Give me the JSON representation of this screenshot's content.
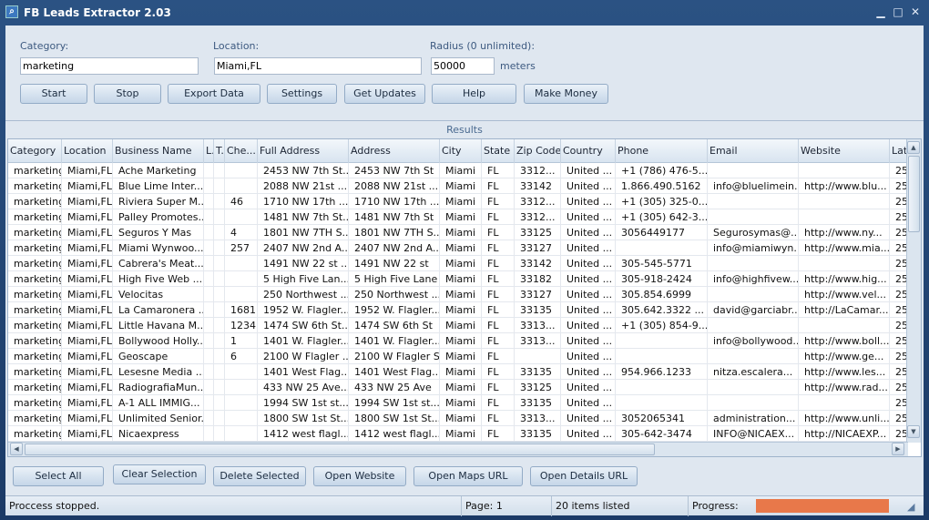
{
  "window": {
    "title": "FB Leads Extractor 2.03"
  },
  "form": {
    "category_label": "Category:",
    "category_value": "marketing",
    "location_label": "Location:",
    "location_value": "Miami,FL",
    "radius_label": "Radius (0 unlimited):",
    "radius_value": "50000",
    "radius_unit": "meters"
  },
  "toolbar": {
    "start": "Start",
    "stop": "Stop",
    "export": "Export Data",
    "settings": "Settings",
    "updates": "Get Updates",
    "help": "Help",
    "money": "Make Money"
  },
  "results_title": "Results",
  "table": {
    "columns": [
      "Category",
      "Location",
      "Business Name",
      "L.",
      "T.",
      "Che...",
      "Full Address",
      "Address",
      "City",
      "State",
      "Zip Code",
      "Country",
      "Phone",
      "Email",
      "Website",
      "Lat"
    ],
    "rows": [
      [
        "marketing",
        "Miami,FL",
        "Ache Marketing",
        "",
        "",
        "",
        "2453 NW 7th St...",
        "2453 NW 7th St",
        "Miami",
        "FL",
        "3312...",
        "United ...",
        "+1 (786) 476-5...",
        "",
        "",
        "25"
      ],
      [
        "marketing",
        "Miami,FL",
        "Blue Lime Inter...",
        "",
        "",
        "",
        "2088 NW 21st ...",
        "2088 NW 21st ...",
        "Miami",
        "FL",
        "33142",
        "United ...",
        "1.866.490.5162",
        "info@bluelimein...",
        "http://www.blu...",
        "25"
      ],
      [
        "marketing",
        "Miami,FL",
        "Riviera Super M...",
        "",
        "",
        "46",
        "1710 NW 17th ...",
        "1710 NW 17th ...",
        "Miami",
        "FL",
        "3312...",
        "United ...",
        "+1 (305) 325-0...",
        "",
        "",
        "25"
      ],
      [
        "marketing",
        "Miami,FL",
        "Palley Promotes...",
        "",
        "",
        "",
        "1481 NW 7th St...",
        "1481 NW 7th St",
        "Miami",
        "FL",
        "3312...",
        "United ...",
        "+1 (305) 642-3...",
        "",
        "",
        "25"
      ],
      [
        "marketing",
        "Miami,FL",
        "Seguros Y Mas",
        "",
        "",
        "4",
        "1801 NW 7TH S...",
        "1801 NW 7TH S...",
        "Miami",
        "FL",
        "33125",
        "United ...",
        "3056449177",
        "Segurosymas@...",
        "http://www.ny...",
        "25"
      ],
      [
        "marketing",
        "Miami,FL",
        "Miami Wynwoo...",
        "",
        "",
        "257",
        "2407 NW 2nd A...",
        "2407 NW 2nd A...",
        "Miami",
        "FL",
        "33127",
        "United ...",
        "",
        "info@miamiwyn...",
        "http://www.mia...",
        "25"
      ],
      [
        "marketing",
        "Miami,FL",
        "Cabrera's Meat...",
        "",
        "",
        "",
        "1491 NW 22 st ...",
        "1491 NW 22 st",
        "Miami",
        "FL",
        "33142",
        "United ...",
        "305-545-5771",
        "",
        "",
        "25"
      ],
      [
        "marketing",
        "Miami,FL",
        "High Five Web ...",
        "",
        "",
        "",
        "5 High Five Lan...",
        "5 High Five Lane",
        "Miami",
        "FL",
        "33182",
        "United ...",
        "305-918-2424",
        "info@highfivew...",
        "http://www.hig...",
        "25"
      ],
      [
        "marketing",
        "Miami,FL",
        "Velocitas",
        "",
        "",
        "",
        "250 Northwest ...",
        "250 Northwest ...",
        "Miami",
        "FL",
        "33127",
        "United ...",
        "305.854.6999",
        "",
        "http://www.vel...",
        "25"
      ],
      [
        "marketing",
        "Miami,FL",
        "La Camaronera ...",
        "",
        "",
        "1681",
        "1952 W. Flagler...",
        "1952 W. Flagler...",
        "Miami",
        "FL",
        "33135",
        "United ...",
        "305.642.3322 ...",
        "david@garciabr...",
        "http://LaCamar...",
        "25"
      ],
      [
        "marketing",
        "Miami,FL",
        "Little Havana M...",
        "",
        "",
        "1234",
        "1474 SW 6th St...",
        "1474 SW 6th St",
        "Miami",
        "FL",
        "3313...",
        "United ...",
        "+1 (305) 854-9...",
        "",
        "",
        "25"
      ],
      [
        "marketing",
        "Miami,FL",
        "Bollywood Holly...",
        "",
        "",
        "1",
        "1401 W. Flagler...",
        "1401 W. Flagler...",
        "Miami",
        "FL",
        "3313...",
        "United ...",
        "",
        "info@bollywood...",
        "http://www.boll...",
        "25"
      ],
      [
        "marketing",
        "Miami,FL",
        "Geoscape",
        "",
        "",
        "6",
        "2100 W Flagler ...",
        "2100 W Flagler St",
        "Miami",
        "FL",
        "",
        "United ...",
        "",
        "",
        "http://www.ge...",
        "25"
      ],
      [
        "marketing",
        "Miami,FL",
        "Lesesne Media ...",
        "",
        "",
        "",
        "1401 West Flag...",
        "1401 West Flag...",
        "Miami",
        "FL",
        "33135",
        "United ...",
        "954.966.1233",
        "nitza.escalera...",
        "http://www.les...",
        "25"
      ],
      [
        "marketing",
        "Miami,FL",
        "RadiografiaMun...",
        "",
        "",
        "",
        "433 NW 25 Ave...",
        "433 NW 25 Ave",
        "Miami",
        "FL",
        "33125",
        "United ...",
        "",
        "",
        "http://www.rad...",
        "25"
      ],
      [
        "marketing",
        "Miami,FL",
        "A-1 ALL IMMIG...",
        "",
        "",
        "",
        "1994 SW 1st st...",
        "1994 SW 1st st...",
        "Miami",
        "FL",
        "33135",
        "United ...",
        "",
        "",
        "",
        "25"
      ],
      [
        "marketing",
        "Miami,FL",
        "Unlimited Senior...",
        "",
        "",
        "",
        "1800 SW 1st St...",
        "1800 SW 1st St...",
        "Miami",
        "FL",
        "3313...",
        "United ...",
        "3052065341",
        "administration...",
        "http://www.unli...",
        "25"
      ],
      [
        "marketing",
        "Miami,FL",
        "Nicaexpress",
        "",
        "",
        "",
        "1412 west flagl...",
        "1412 west flagl...",
        "Miami",
        "FL",
        "33135",
        "United ...",
        "305-642-3474",
        "INFO@NICAEX...",
        "http://NICAEXP...",
        "25"
      ]
    ]
  },
  "actions": {
    "select_all": "Select All",
    "clear": "Clear Selection",
    "delete": "Delete Selected",
    "website": "Open Website",
    "maps": "Open Maps URL",
    "details": "Open Details URL"
  },
  "status": {
    "message": "Proccess stopped.",
    "page": "Page: 1",
    "count": "20 items listed",
    "progress_label": "Progress:",
    "progress_percent": 100,
    "progress_color": "#e8784a"
  }
}
